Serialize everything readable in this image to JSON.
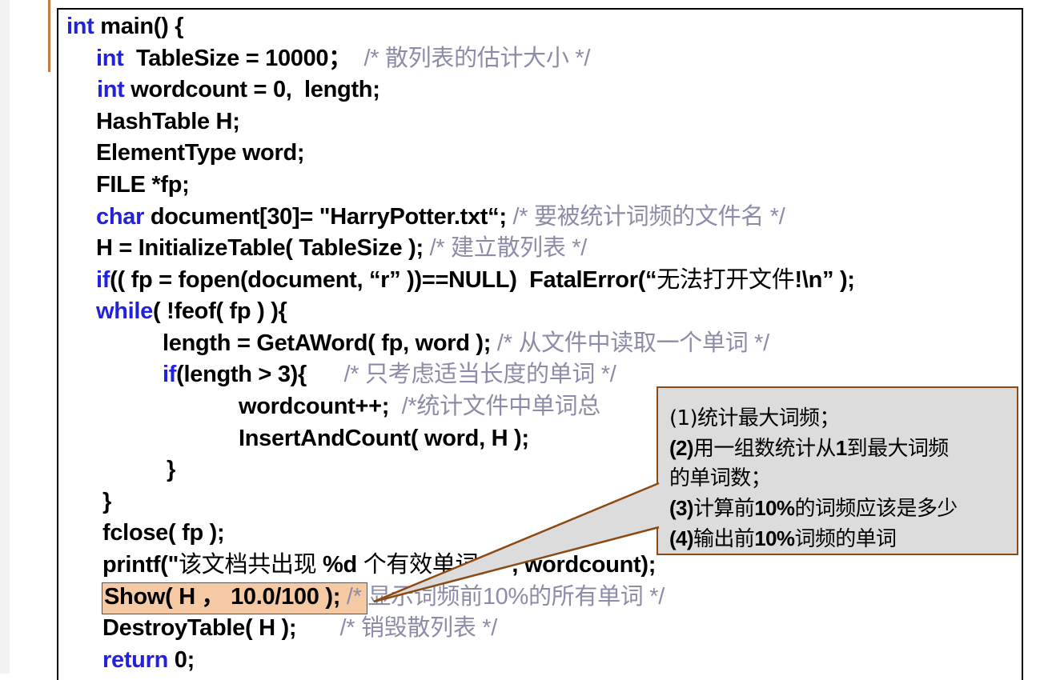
{
  "code": {
    "l1": {
      "kw": "int",
      "t": " main() {"
    },
    "l2": {
      "kw": "int",
      "t": "  TableSize = 10000；",
      "c": "/* 散列表的估计大小 */"
    },
    "l3": {
      "kw": "int",
      "t": " wordcount = 0,  length;"
    },
    "l4": {
      "t": "HashTable H;"
    },
    "l5": {
      "t": "ElementType word;"
    },
    "l6": {
      "t": "FILE *fp;"
    },
    "l7": {
      "kw": "char",
      "t": " document[30]= \"HarryPotter.txt“; ",
      "c": "/* 要被统计词频的文件名 */"
    },
    "l8": {
      "t": "H = InitializeTable( TableSize ); ",
      "c": "/* 建立散列表 */"
    },
    "l9": {
      "kw": "if",
      "t": "(( fp = fopen(document, “r” ))==NULL)  FatalError(“",
      "cn": "无法打开文件",
      "t2": "!\\n” );"
    },
    "l10": {
      "kw": "while",
      "t": "( !feof( fp ) ){"
    },
    "l11": {
      "t": "length = GetAWord( fp, word ); ",
      "c": "/* 从文件中读取一个单词 */"
    },
    "l12": {
      "kw": "if",
      "t": "(length > 3){      ",
      "c": "/* 只考虑适当长度的单词 */"
    },
    "l13": {
      "t": "wordcount++;  ",
      "c": "/*统计文件中单词总"
    },
    "l14": {
      "t": "InsertAndCount( word, H );"
    },
    "l15": {
      "t": "}"
    },
    "l16": {
      "t": "}"
    },
    "l17": {
      "t": "fclose( fp );"
    },
    "l18": {
      "t": "printf(\"",
      "cn": "该文档共出现",
      "t2": " %d ",
      "cn2": "个有效单词，",
      "t3": "\", wordcount);"
    },
    "l19": {
      "t": "Show( H ， 10.0/100 );",
      "c": " /* 显示词频前10%的所有单词 */"
    },
    "l20": {
      "t": "DestroyTable( H );       ",
      "c": "/* 销毁散列表 */"
    },
    "l21": {
      "kw": "return",
      "t": " 0;"
    }
  },
  "callout": {
    "n1_num": "(1)",
    "n1_text": "统计最大词频；",
    "n2_num": "(2)",
    "n2_text_a": "用一组数统计从",
    "n2_bold": "1",
    "n2_text_b": "到最大词频",
    "n2_cont": "的单词数；",
    "n3_num": "(3)",
    "n3_text_a": "计算前",
    "n3_bold": "10%",
    "n3_text_b": "的词频应该是多少",
    "n4_num": "(4)",
    "n4_text_a": "输出前",
    "n4_bold": "10%",
    "n4_text_b": "词频的单词"
  },
  "colors": {
    "keyword": "#2222dd",
    "comment": "#8c8ca8",
    "highlight": "#f4c9a3",
    "callout_border": "#8b4a14",
    "callout_fill": "#dcdcdc"
  }
}
